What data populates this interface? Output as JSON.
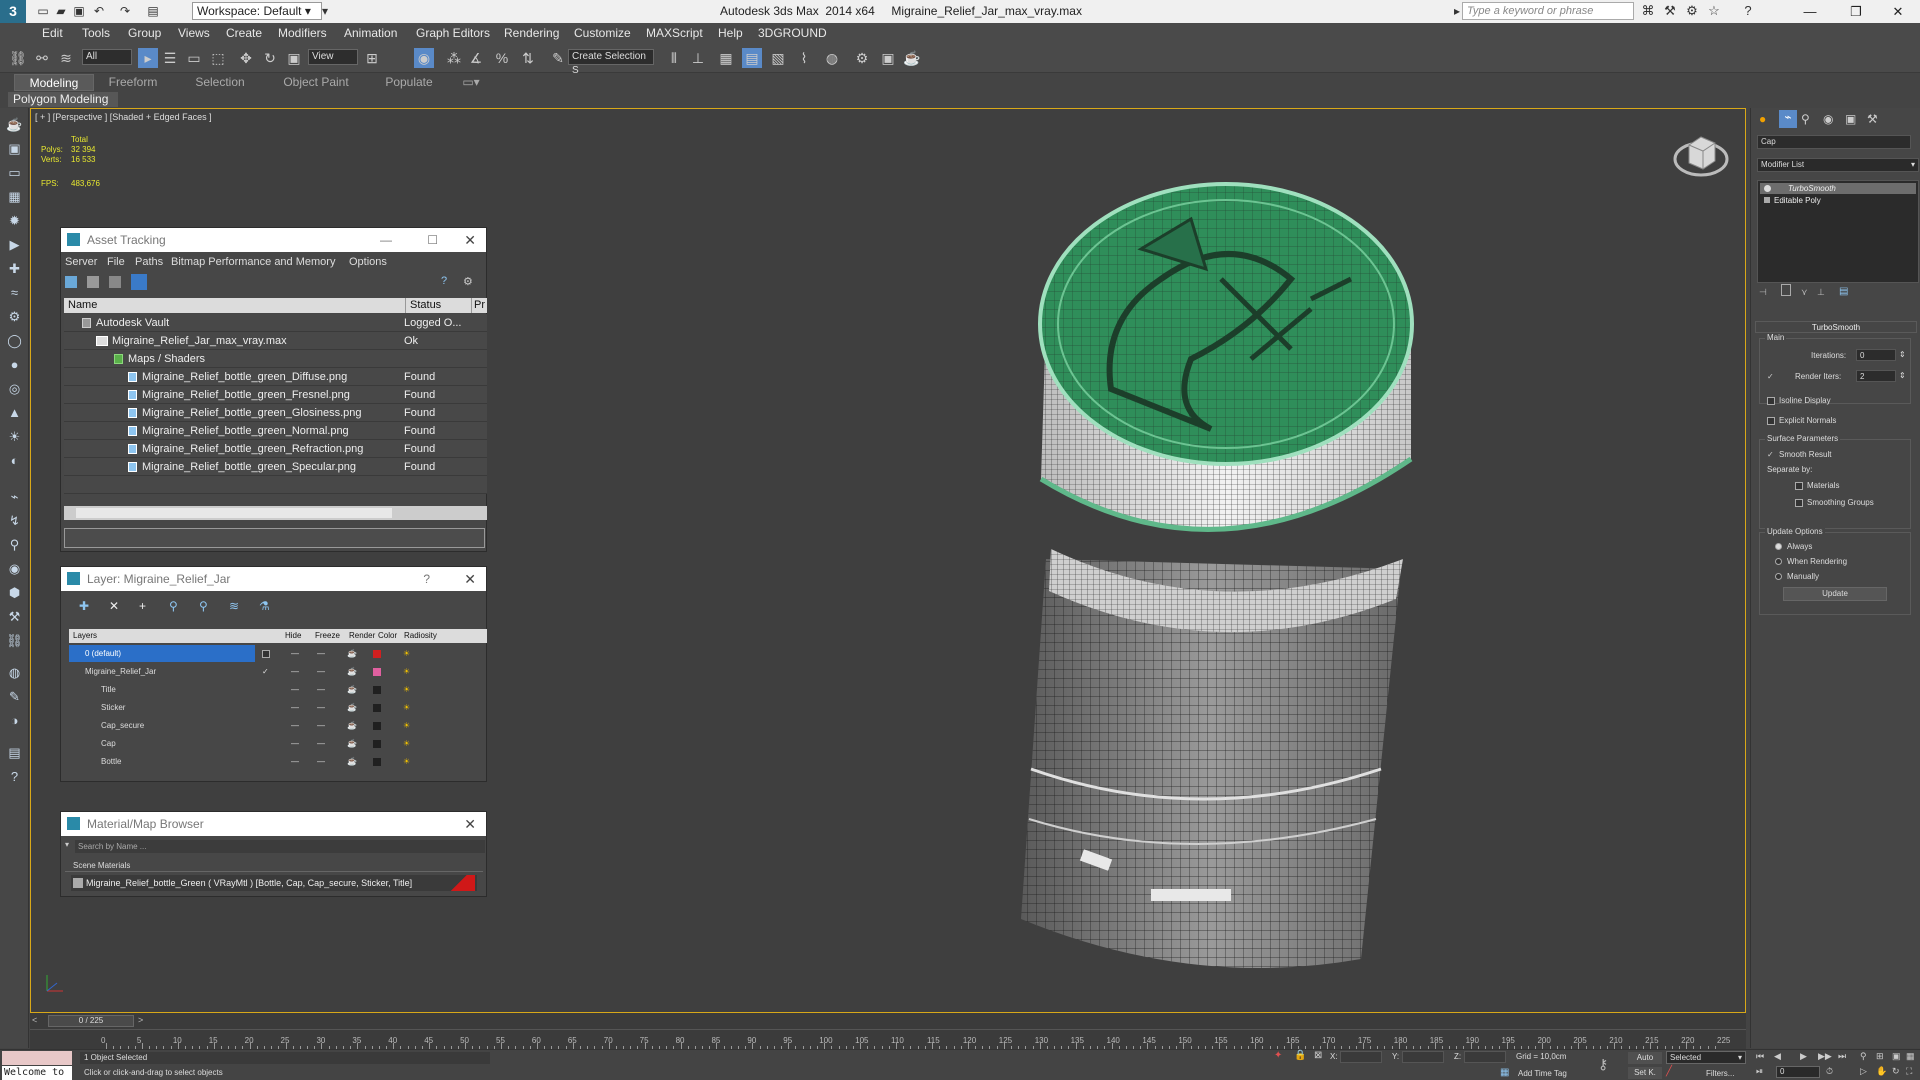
{
  "titlebar": {
    "workspace": "Workspace: Default",
    "app_title": "Autodesk 3ds Max  2014 x64     Migraine_Relief_Jar_max_vray.max",
    "search_placeholder": "Type a keyword or phrase"
  },
  "menu": [
    "Edit",
    "Tools",
    "Group",
    "Views",
    "Create",
    "Modifiers",
    "Animation",
    "Graph Editors",
    "Rendering",
    "Customize",
    "MAXScript",
    "Help",
    "3DGROUND"
  ],
  "toolbar": {
    "filter": "All",
    "refcoord": "View",
    "named_selection": "Create Selection S"
  },
  "ribbon": {
    "tabs": [
      "Modeling",
      "Freeform",
      "Selection",
      "Object Paint",
      "Populate"
    ],
    "active_tab": "Modeling",
    "sub_label": "Polygon Modeling"
  },
  "viewport": {
    "label": "[ + ] [Perspective ] [Shaded + Edged Faces ]",
    "stats": {
      "total_label": "Total",
      "polys_label": "Polys:",
      "polys": "32 394",
      "verts_label": "Verts:",
      "verts": "16 533",
      "fps_label": "FPS:",
      "fps": "483,676"
    }
  },
  "asset_tracking": {
    "title": "Asset Tracking",
    "menu": [
      "Server",
      "File",
      "Paths",
      "Bitmap Performance and Memory",
      "Options"
    ],
    "columns": [
      "Name",
      "Status",
      "Pr"
    ],
    "rows": [
      {
        "name": "Autodesk Vault",
        "status": "Logged O..."
      },
      {
        "name": "Migraine_Relief_Jar_max_vray.max",
        "status": "Ok"
      },
      {
        "name": "Maps / Shaders",
        "status": ""
      },
      {
        "name": "Migraine_Relief_bottle_green_Diffuse.png",
        "status": "Found"
      },
      {
        "name": "Migraine_Relief_bottle_green_Fresnel.png",
        "status": "Found"
      },
      {
        "name": "Migraine_Relief_bottle_green_Glosiness.png",
        "status": "Found"
      },
      {
        "name": "Migraine_Relief_bottle_green_Normal.png",
        "status": "Found"
      },
      {
        "name": "Migraine_Relief_bottle_green_Refraction.png",
        "status": "Found"
      },
      {
        "name": "Migraine_Relief_bottle_green_Specular.png",
        "status": "Found"
      }
    ]
  },
  "layers": {
    "title": "Layer: Migraine_Relief_Jar",
    "columns": [
      "Layers",
      "Hide",
      "Freeze",
      "Render",
      "Color",
      "Radiosity"
    ],
    "rows": [
      {
        "name": "0 (default)",
        "color": "#d02020"
      },
      {
        "name": "Migraine_Relief_Jar",
        "color": "#e060a0"
      },
      {
        "name": "Title",
        "color": "#202020"
      },
      {
        "name": "Sticker",
        "color": "#202020"
      },
      {
        "name": "Cap_secure",
        "color": "#202020"
      },
      {
        "name": "Cap",
        "color": "#202020"
      },
      {
        "name": "Bottle",
        "color": "#202020"
      }
    ]
  },
  "material_browser": {
    "title": "Material/Map Browser",
    "search_placeholder": "Search by Name ...",
    "section": "Scene Materials",
    "item": "Migraine_Relief_bottle_Green  ( VRayMtl ) [Bottle, Cap, Cap_secure, Sticker, Title]"
  },
  "command_panel": {
    "object_name": "Cap",
    "modifier_list": "Modifier List",
    "stack": [
      "TurboSmooth",
      "Editable Poly"
    ],
    "rollout_title": "TurboSmooth",
    "main_label": "Main",
    "iterations_label": "Iterations:",
    "iterations": "0",
    "render_iters_label": "Render Iters:",
    "render_iters": "2",
    "isoline": "Isoline Display",
    "explicit_normals": "Explicit Normals",
    "surface_params": "Surface Parameters",
    "smooth_result": "Smooth Result",
    "separate_by": "Separate by:",
    "materials": "Materials",
    "smoothing_groups": "Smoothing Groups",
    "update_options": "Update Options",
    "always": "Always",
    "when_rendering": "When Rendering",
    "manually": "Manually",
    "update_button": "Update"
  },
  "timeline": {
    "frame": "0 / 225",
    "ticks": [
      "0",
      "5",
      "10",
      "15",
      "20",
      "25",
      "30",
      "35",
      "40",
      "45",
      "50",
      "55",
      "60",
      "65",
      "70",
      "75",
      "80",
      "85",
      "90",
      "95",
      "100",
      "105",
      "110",
      "115",
      "120",
      "125",
      "130",
      "135",
      "140",
      "145",
      "150",
      "155",
      "160",
      "165",
      "170",
      "175",
      "180",
      "185",
      "190",
      "195",
      "200",
      "205",
      "210",
      "215",
      "220",
      "225"
    ]
  },
  "status": {
    "welcome": "Welcome to",
    "selected": "1 Object Selected",
    "prompt": "Click or click-and-drag to select objects",
    "x_label": "X:",
    "y_label": "Y:",
    "z_label": "Z:",
    "grid": "Grid = 10,0cm",
    "add_time_tag": "Add Time Tag",
    "auto": "Auto",
    "selected_dropdown": "Selected",
    "set_k": "Set K.",
    "filters": "Filters...",
    "frame_field": "0"
  }
}
